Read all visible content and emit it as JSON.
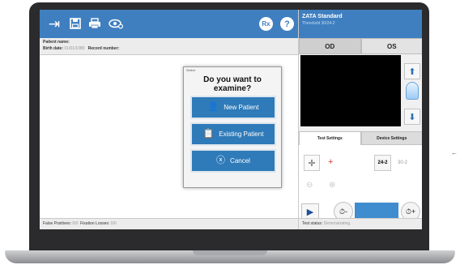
{
  "toolbar": {
    "icons": [
      "enter-icon",
      "save-icon",
      "print-icon",
      "eye-settings-icon"
    ],
    "rx_label": "Rx",
    "help_label": "?"
  },
  "patient": {
    "name_label": "Patient name:",
    "birth_label": "Birth date:",
    "birth_value": "01/01/1980",
    "record_label": "Record number:"
  },
  "left_status": {
    "fp_label": "False Positives:",
    "fp_value": "0/0",
    "fl_label": "Fixation Losses:",
    "fl_value": "0/0"
  },
  "dialog": {
    "title": "Select",
    "question": "Do you want to examine?",
    "new_patient": "New Patient",
    "existing_patient": "Existing Patient",
    "cancel": "Cancel"
  },
  "exam": {
    "title": "ZATA Standard",
    "subtitle": "Threshold 30/24-2",
    "tabs": [
      "OD",
      "OS"
    ]
  },
  "settings": {
    "tabs": [
      "Test Settings",
      "Device Settings"
    ],
    "pattern_selected": "24-2",
    "pattern_other": "30-2",
    "speed_down": "⏱-",
    "speed_up": "⏱+"
  },
  "right_status": {
    "label": "Test status:",
    "value": "Demonstrating"
  },
  "colors": {
    "toolbar_blue": "#3f7fc0",
    "button_blue": "#2f7ab8"
  }
}
